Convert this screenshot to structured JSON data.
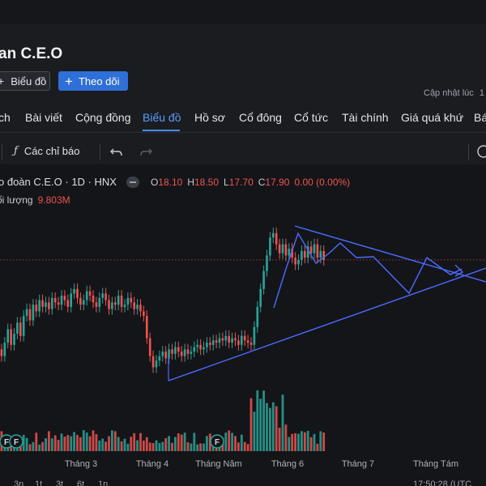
{
  "company": {
    "title_fragment": "an C.E.O"
  },
  "header_buttons": {
    "chart_label": "Biểu đồ",
    "follow_label": "Theo dõi"
  },
  "updated": {
    "label": "Cập nhật lúc",
    "value": "1"
  },
  "tabs": [
    {
      "label": "ch",
      "active": false
    },
    {
      "label": "Bài viết",
      "active": false
    },
    {
      "label": "Cộng đồng",
      "active": false
    },
    {
      "label": "Biểu đồ",
      "active": true
    },
    {
      "label": "Hồ sơ",
      "active": false
    },
    {
      "label": "Cổ đông",
      "active": false
    },
    {
      "label": "Cổ tức",
      "active": false
    },
    {
      "label": "Tài chính",
      "active": false
    },
    {
      "label": "Giá quá khứ",
      "active": false
    },
    {
      "label": "Bá",
      "active": false
    }
  ],
  "toolbar": {
    "indicators_label": "Các chỉ báo",
    "undo_icon": "undo-icon",
    "redo_icon": "redo-icon",
    "fx_icon": "fx-icon"
  },
  "legend": {
    "symbol": "o đoàn C.E.O · 1D · HNX",
    "open_label": "O",
    "open": "18.10",
    "high_label": "H",
    "high": "18.50",
    "low_label": "L",
    "low": "17.70",
    "close_label": "C",
    "close": "17.90",
    "change": "0.00 (0.00%)",
    "volume_label": "ối lượng",
    "volume": "9.803M"
  },
  "colors": {
    "up": "#26a69a",
    "down": "#ef5350",
    "drawing": "#4a6cff",
    "accent": "#2f6fd8",
    "tab_active": "#5d9bff",
    "price_line": "#ef5350"
  },
  "chart_data": {
    "type": "candlestick",
    "interval": "1D",
    "exchange": "HNX",
    "x_axis_labels": [
      "Tháng 3",
      "Tháng 4",
      "Tháng Năm",
      "Tháng 6",
      "Tháng 7",
      "Tháng Tám"
    ],
    "last_ohlc": {
      "open": 18.1,
      "high": 18.5,
      "low": 17.7,
      "close": 17.9
    },
    "last_volume": "9.803M",
    "price_range_approx": [
      12.5,
      19.2
    ],
    "events": [
      {
        "label": "F",
        "position": "early-march"
      },
      {
        "label": "F",
        "position": "early-march"
      },
      {
        "label": "F",
        "position": "early-may"
      }
    ],
    "drawings": [
      "descending trendline from June high toward right",
      "ascending trendline from April low toward right",
      "projected zig-zag path to apex"
    ]
  },
  "bottom_strip": {
    "ranges": [
      "3n",
      "1t",
      "3t",
      "6t",
      "1n"
    ],
    "time": "17:50:28 (UTC"
  }
}
